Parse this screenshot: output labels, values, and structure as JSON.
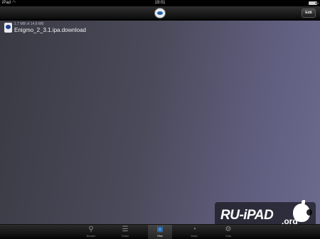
{
  "status_bar": {
    "carrier": "iPad",
    "time": "19:01",
    "battery_level": 0.9
  },
  "nav_bar": {
    "edit_label": "Edit"
  },
  "downloads": [
    {
      "progress_text": "1.7 MB of 14.8 MB",
      "file_name": "Enigmo_2_3.1.ipa.download"
    }
  ],
  "tab_bar": {
    "tabs": [
      {
        "label": "Browser",
        "icon": "search-icon"
      },
      {
        "label": "Folder",
        "icon": "database-icon"
      },
      {
        "label": "Files",
        "icon": "save-icon",
        "selected": true
      },
      {
        "label": "Share",
        "icon": "rss-icon"
      },
      {
        "label": "Tools",
        "icon": "settings-search-icon"
      }
    ]
  },
  "watermark": {
    "text": "RU-iPAD",
    "suffix": ".org"
  }
}
